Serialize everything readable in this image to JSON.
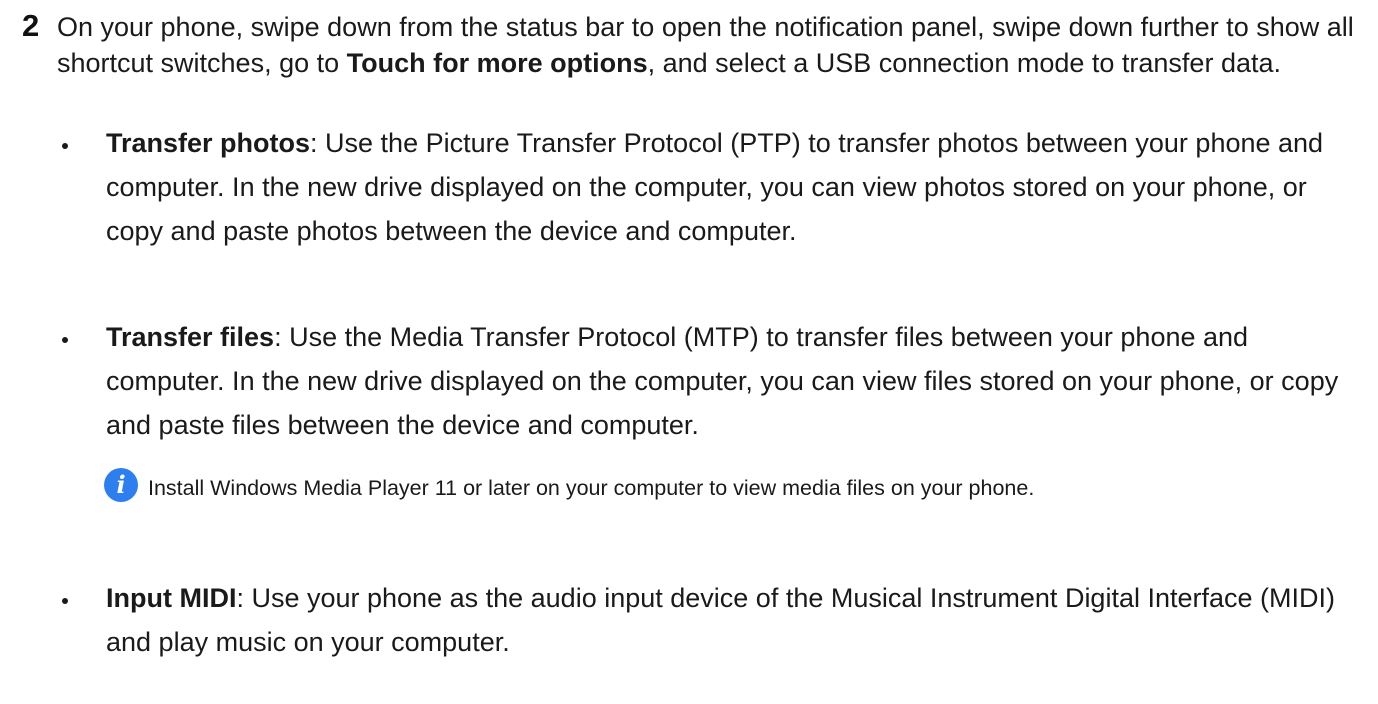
{
  "step": {
    "number": "2",
    "text_before": "On your phone, swipe down from the status bar to open the notification panel, swipe down further to show all shortcut switches, go to ",
    "bold_option": "Touch for more options",
    "text_after": ", and select a USB connection mode to transfer data."
  },
  "bullets": [
    {
      "term": "Transfer photos",
      "description": ": Use the Picture Transfer Protocol (PTP) to transfer photos between your phone and computer. In the new drive displayed on the computer, you can view photos stored on your phone, or copy and paste photos between the device and computer."
    },
    {
      "term": "Transfer files",
      "description": ": Use the Media Transfer Protocol (MTP) to transfer files between your phone and computer. In the new drive displayed on the computer, you can view files stored on your phone, or copy and paste files between the device and computer."
    },
    {
      "term": "Input MIDI",
      "description": ": Use your phone as the audio input device of the Musical Instrument Digital Interface (MIDI) and play music on your computer."
    }
  ],
  "note": {
    "icon": "info-icon",
    "icon_glyph": "i",
    "icon_color": "#2d7ff0",
    "text": "Install Windows Media Player 11 or later on your computer to view media files on your phone."
  }
}
